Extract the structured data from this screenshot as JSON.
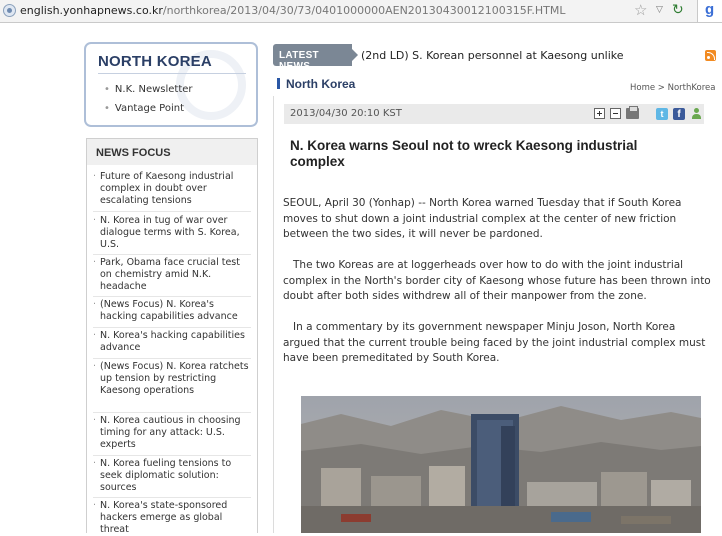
{
  "browser": {
    "url_host": "english.yonhapnews.co.kr",
    "url_path": "/northkorea/2013/04/30/73/0401000000AEN20130430012100315F.HTML",
    "search_logo": "g"
  },
  "sidebar": {
    "title": "NORTH KOREA",
    "nav_items": [
      "N.K. Newsletter",
      "Vantage Point"
    ],
    "news_focus": {
      "heading": "NEWS FOCUS",
      "items": [
        "Future of Kaesong industrial complex in doubt over escalating tensions",
        "N. Korea in tug of war over dialogue terms with S. Korea, U.S.",
        "Park, Obama face crucial test on chemistry amid N.K. headache",
        "(News Focus) N. Korea's hacking capabilities advance",
        "N. Korea's hacking capabilities advance",
        "(News Focus) N. Korea ratchets up tension by restricting Kaesong operations",
        "N. Korea cautious in choosing timing for any attack: U.S. experts",
        "N. Korea fueling tensions to seek diplomatic solution: sources",
        "N. Korea's state-sponsored hackers emerge as global threat"
      ]
    }
  },
  "latest_news": {
    "label": "LATEST NEWS",
    "headline": "(2nd LD) S. Korean personnel at Kaesong unlike"
  },
  "section": {
    "name": "North Korea",
    "breadcrumb": "Home > NorthKorea"
  },
  "article": {
    "datetime": "2013/04/30 20:10 KST",
    "title": "N. Korea warns Seoul not to wreck Kaesong industrial complex",
    "paragraphs": [
      "SEOUL, April 30 (Yonhap) -- North Korea warned Tuesday that if South Korea moves to shut down a joint industrial complex at the center of new friction between the two sides, it will never be pardoned.",
      "   The two Koreas are at loggerheads over how to do with the joint industrial complex in the North's border city of Kaesong whose future has been thrown into doubt after both sides withdrew all of their manpower from the zone.",
      "   In a commentary by its government newspaper Minju Joson, North Korea argued that the current trouble being faced by the joint industrial complex must have been premeditated by South Korea."
    ],
    "tools": {
      "twitter_glyph": "t",
      "facebook_glyph": "f"
    }
  },
  "icons": [
    "favicon-icon",
    "star-icon",
    "dropdown-icon",
    "reload-icon",
    "rss-icon",
    "zoom-in-icon",
    "zoom-out-icon",
    "print-icon",
    "twitter-icon",
    "facebook-icon",
    "user-icon"
  ],
  "colors": {
    "brand_navy": "#2b3f66",
    "latest_label_bg": "#7b8795",
    "section_marker": "#2a57a5",
    "rss_orange": "#f28b22"
  }
}
